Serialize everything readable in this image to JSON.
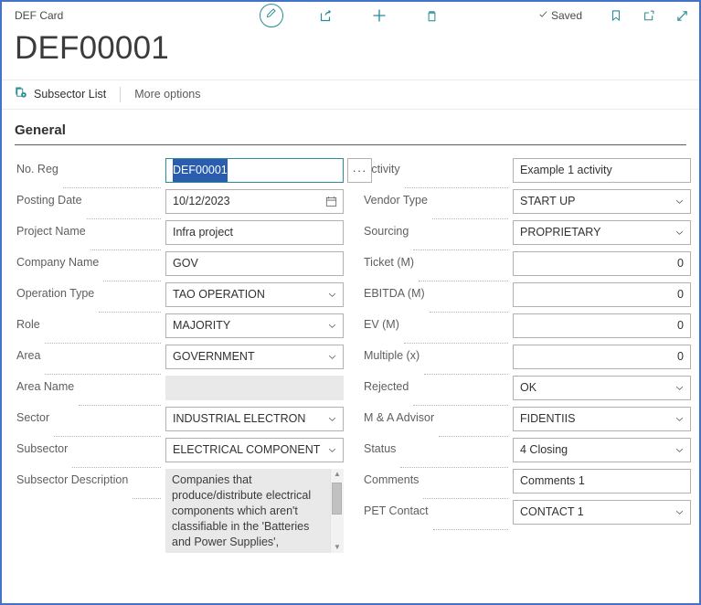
{
  "window": {
    "border_color": "#4472c4"
  },
  "topbar": {
    "page_caption": "DEF Card",
    "actions": [
      {
        "name": "edit-action",
        "icon": "pencil-icon",
        "label": "Edit"
      },
      {
        "name": "share-action",
        "icon": "share-icon",
        "label": "Share"
      },
      {
        "name": "new-action",
        "icon": "plus-icon",
        "label": "New"
      },
      {
        "name": "delete-action",
        "icon": "trash-icon",
        "label": "Delete"
      }
    ],
    "saved_label": "Saved",
    "right_icons": [
      {
        "name": "bookmark-button",
        "icon": "bookmark-icon"
      },
      {
        "name": "open-in-new-window-button",
        "icon": "open-new-window-icon"
      },
      {
        "name": "expand-button",
        "icon": "expand-diagonal-icon"
      }
    ],
    "accent_color": "#2a8c94"
  },
  "record": {
    "title": "DEF00001"
  },
  "ribbon": {
    "primary_action": {
      "label": "Subsector List",
      "icon": "list-settings-icon"
    },
    "more_options": "More options"
  },
  "general": {
    "heading": "General",
    "left_fields": [
      {
        "label": "No. Reg",
        "value": "DEF00001",
        "type": "text-assist",
        "focused": true,
        "selected": true
      },
      {
        "label": "Posting Date",
        "value": "10/12/2023",
        "type": "date"
      },
      {
        "label": "Project Name",
        "value": "Infra project",
        "type": "text"
      },
      {
        "label": "Company Name",
        "value": "GOV",
        "type": "text"
      },
      {
        "label": "Operation Type",
        "value": "TAO OPERATION",
        "type": "dropdown"
      },
      {
        "label": "Role",
        "value": "MAJORITY",
        "type": "dropdown"
      },
      {
        "label": "Area",
        "value": "GOVERNMENT",
        "type": "dropdown"
      },
      {
        "label": "Area Name",
        "value": "",
        "type": "disabled"
      },
      {
        "label": "Sector",
        "value": "INDUSTRIAL ELECTRON",
        "type": "dropdown"
      },
      {
        "label": "Subsector",
        "value": "ELECTRICAL COMPONENT",
        "type": "dropdown"
      },
      {
        "label": "Subsector Description",
        "value": "Companies that produce/distribute electrical components which aren't classifiable in the 'Batteries and Power Supplies', 'Process",
        "type": "textarea"
      }
    ],
    "right_fields": [
      {
        "label": "Activity",
        "value": "Example 1 activity",
        "type": "text"
      },
      {
        "label": "Vendor Type",
        "value": "START UP",
        "type": "dropdown"
      },
      {
        "label": "Sourcing",
        "value": "PROPRIETARY",
        "type": "dropdown"
      },
      {
        "label": "Ticket (M)",
        "value": "0",
        "type": "number"
      },
      {
        "label": "EBITDA (M)",
        "value": "0",
        "type": "number"
      },
      {
        "label": "EV (M)",
        "value": "0",
        "type": "number"
      },
      {
        "label": "Multiple (x)",
        "value": "0",
        "type": "number"
      },
      {
        "label": "Rejected",
        "value": "OK",
        "type": "dropdown"
      },
      {
        "label": "M & A Advisor",
        "value": "FIDENTIIS",
        "type": "dropdown"
      },
      {
        "label": "Status",
        "value": "4 Closing",
        "type": "dropdown"
      },
      {
        "label": "Comments",
        "value": "Comments 1",
        "type": "text"
      },
      {
        "label": "PET Contact",
        "value": "CONTACT 1",
        "type": "dropdown"
      }
    ],
    "assist_edit_label": "···"
  }
}
